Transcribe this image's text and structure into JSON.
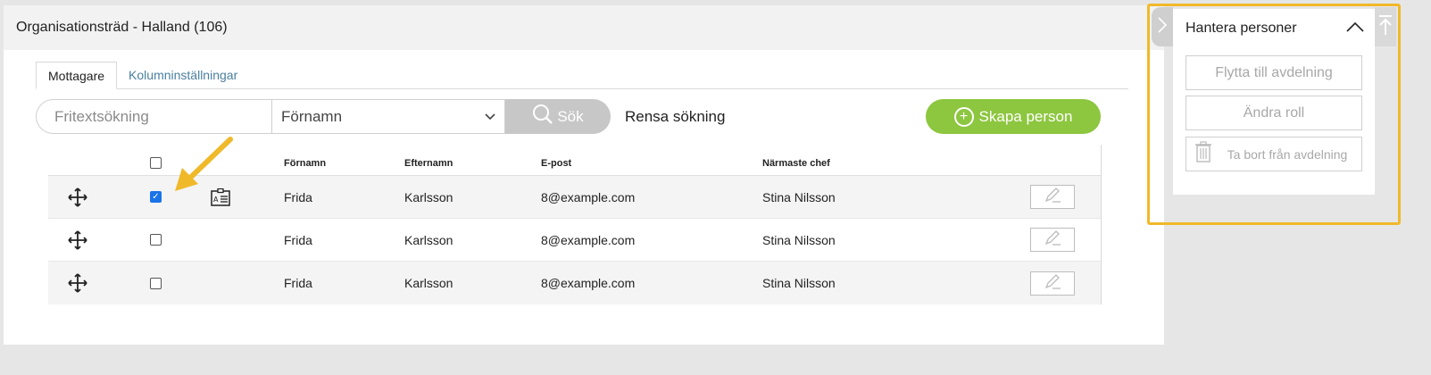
{
  "header": {
    "title": "Organisationsträd - Halland (106)"
  },
  "tabs": [
    {
      "label": "Mottagare",
      "active": true
    },
    {
      "label": "Kolumninställningar",
      "active": false
    }
  ],
  "search": {
    "placeholder": "Fritextsökning",
    "field_selected": "Förnamn",
    "search_label": "Sök",
    "clear_label": "Rensa sökning",
    "create_label": "Skapa person"
  },
  "table": {
    "columns": {
      "firstname": "Förnamn",
      "lastname": "Efternamn",
      "email": "E-post",
      "manager": "Närmaste chef"
    },
    "rows": [
      {
        "firstname": "Frida",
        "lastname": "Karlsson",
        "email": "8@example.com",
        "manager": "Stina Nilsson",
        "checked": true
      },
      {
        "firstname": "Frida",
        "lastname": "Karlsson",
        "email": "8@example.com",
        "manager": "Stina Nilsson",
        "checked": false
      },
      {
        "firstname": "Frida",
        "lastname": "Karlsson",
        "email": "8@example.com",
        "manager": "Stina Nilsson",
        "checked": false
      }
    ]
  },
  "side_panel": {
    "title": "Hantera personer",
    "move_label": "Flytta till avdelning",
    "role_label": "Ändra roll",
    "remove_label": "Ta bort från avdelning"
  },
  "colors": {
    "create_button": "#8dc63f",
    "search_button": "#c7c7c7",
    "highlight": "#f0b92a",
    "checkbox": "#1a73e8"
  }
}
